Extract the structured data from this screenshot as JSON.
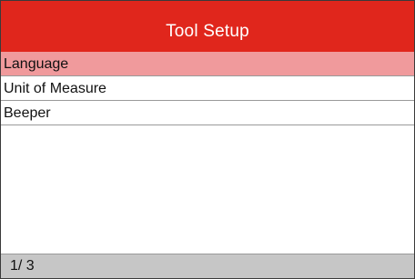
{
  "title": "Tool Setup",
  "menu": {
    "items": [
      {
        "label": "Language"
      },
      {
        "label": "Unit of Measure"
      },
      {
        "label": "Beeper"
      }
    ],
    "selected_index": 0
  },
  "status": {
    "page": "1/ 3"
  },
  "colors": {
    "title_bar": "#e0261c",
    "selected_row": "#f09a9c",
    "status_bar": "#c6c6c6"
  }
}
